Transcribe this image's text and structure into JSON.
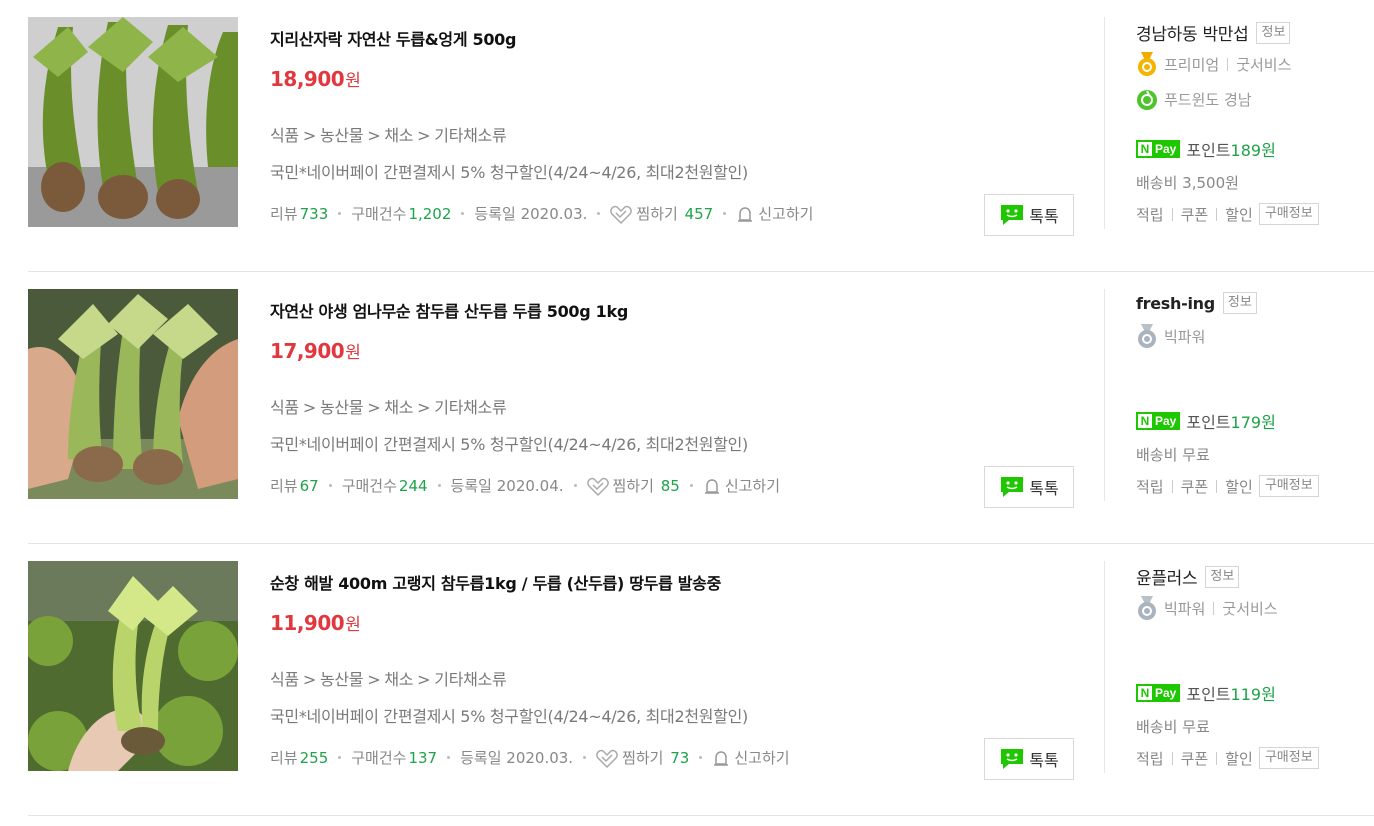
{
  "products": [
    {
      "title": "지리산자락 자연산 두릅&엉게 500g",
      "price": "18,900",
      "price_unit": "원",
      "category": [
        "식품",
        "농산물",
        "채소",
        "기타채소류"
      ],
      "promo": "국민*네이버페이 간편결제시 5% 청구할인(4/24~4/26, 최대2천원할인)",
      "review_label": "리뷰",
      "review_count": "733",
      "purchase_label": "구매건수",
      "purchase_count": "1,202",
      "registered_label": "등록일",
      "registered_date": "2020.03.",
      "wish_label": "찜하기",
      "wish_count": "457",
      "report_label": "신고하기",
      "talk_label": "톡톡",
      "seller": {
        "name": "경남하동 박만섭",
        "info_label": "정보",
        "grade": "프리미엄",
        "service": "굿서비스",
        "badge2": "푸드윈도 경남",
        "point_label": "포인트",
        "point": "189원",
        "shipping": "배송비 3,500원",
        "links": [
          "적립",
          "쿠폰",
          "할인"
        ],
        "buyinfo_label": "구매정보"
      }
    },
    {
      "title": "자연산 야생 엄나무순 참두릅 산두릅 두릅 500g 1kg",
      "price": "17,900",
      "price_unit": "원",
      "category": [
        "식품",
        "농산물",
        "채소",
        "기타채소류"
      ],
      "promo": "국민*네이버페이 간편결제시 5% 청구할인(4/24~4/26, 최대2천원할인)",
      "review_label": "리뷰",
      "review_count": "67",
      "purchase_label": "구매건수",
      "purchase_count": "244",
      "registered_label": "등록일",
      "registered_date": "2020.04.",
      "wish_label": "찜하기",
      "wish_count": "85",
      "report_label": "신고하기",
      "talk_label": "톡톡",
      "seller": {
        "name": "fresh-ing",
        "info_label": "정보",
        "grade": "빅파워",
        "point_label": "포인트",
        "point": "179원",
        "shipping": "배송비 무료",
        "links": [
          "적립",
          "쿠폰",
          "할인"
        ],
        "buyinfo_label": "구매정보"
      }
    },
    {
      "title": "순창 해발 400m 고랭지 참두릅1kg / 두릅 (산두릅) 땅두릅 발송중",
      "price": "11,900",
      "price_unit": "원",
      "category": [
        "식품",
        "농산물",
        "채소",
        "기타채소류"
      ],
      "promo": "국민*네이버페이 간편결제시 5% 청구할인(4/24~4/26, 최대2천원할인)",
      "review_label": "리뷰",
      "review_count": "255",
      "purchase_label": "구매건수",
      "purchase_count": "137",
      "registered_label": "등록일",
      "registered_date": "2020.03.",
      "wish_label": "찜하기",
      "wish_count": "73",
      "report_label": "신고하기",
      "talk_label": "톡톡",
      "seller": {
        "name": "윤플러스",
        "info_label": "정보",
        "grade": "빅파워",
        "service": "굿서비스",
        "point_label": "포인트",
        "point": "119원",
        "shipping": "배송비 무료",
        "links": [
          "적립",
          "쿠폰",
          "할인"
        ],
        "buyinfo_label": "구매정보"
      }
    }
  ],
  "npay_label": "Pay",
  "npay_n": "N",
  "colors": {
    "price": "#e0383e",
    "count_green": "#1ea34a",
    "npay_green": "#1ec800"
  },
  "icons": {
    "premium_medal": "gold-medal-icon",
    "bigpower_medal": "silver-medal-icon",
    "foodwindow": "apple-icon",
    "wish": "heart-icon",
    "report": "bell-icon",
    "talk": "chat-bubble-icon"
  }
}
